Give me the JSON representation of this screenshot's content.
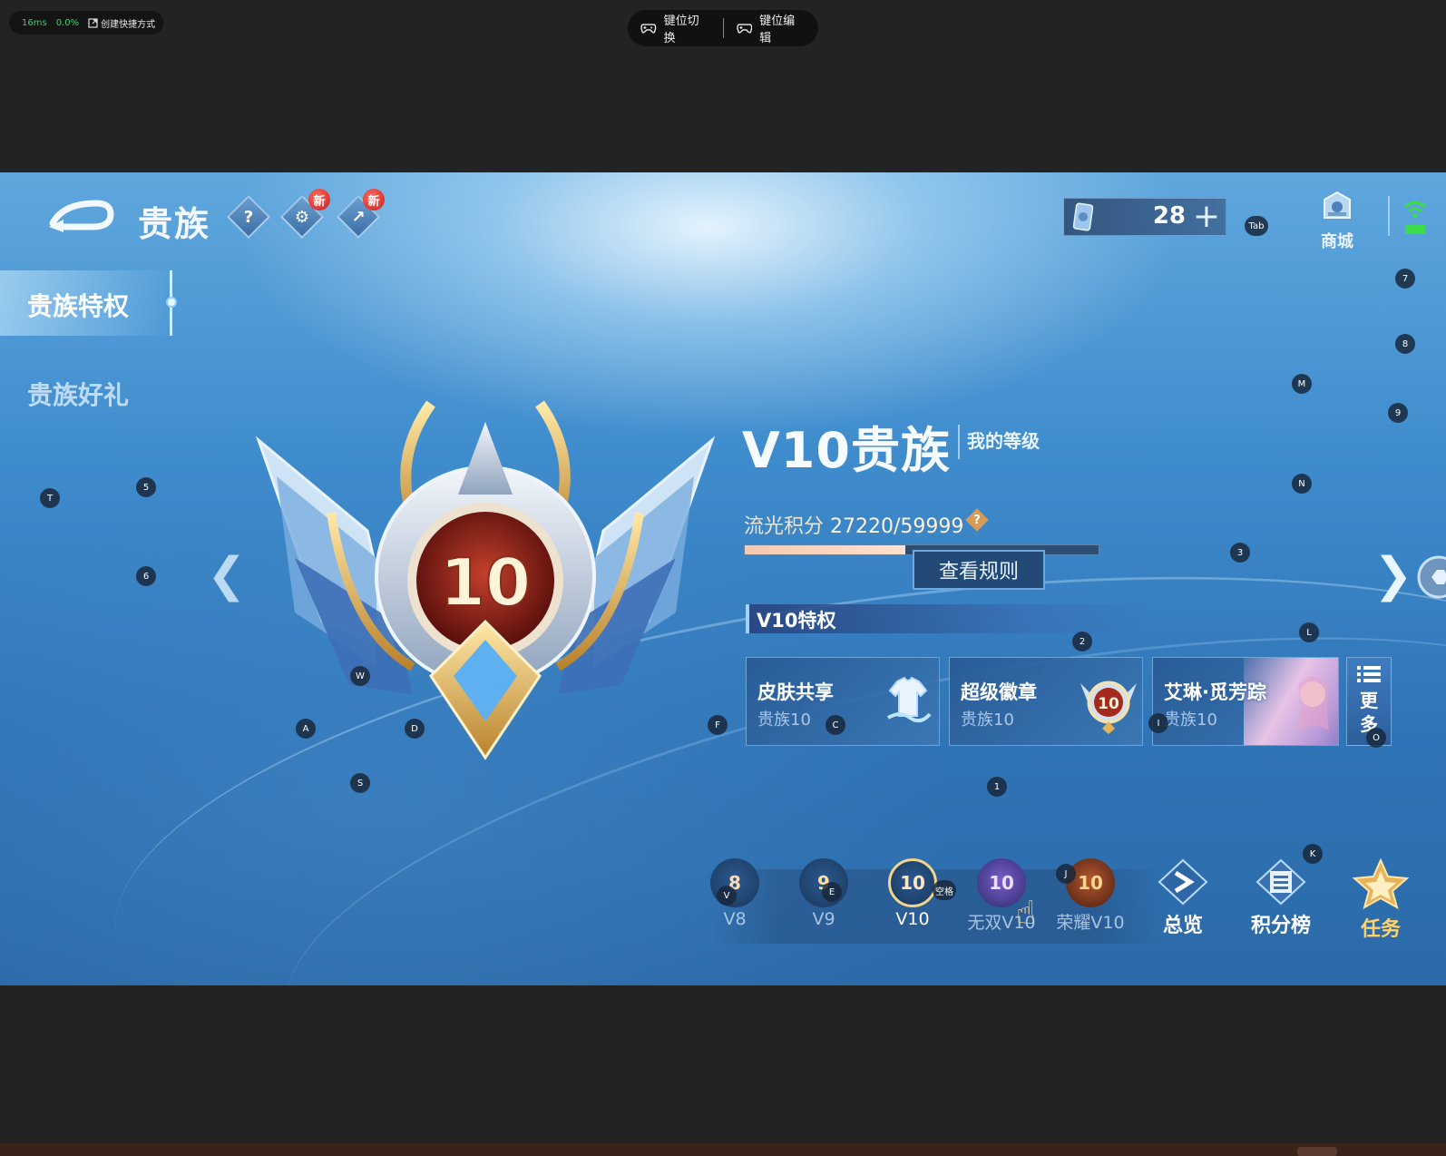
{
  "emulator": {
    "latency": "16ms",
    "loss": "0.0%",
    "shortcut_label": "创建快捷方式",
    "key_switch_label": "键位切换",
    "key_edit_label": "键位编辑"
  },
  "header": {
    "title": "贵族",
    "help_symbol": "?",
    "new_badge_1": "新",
    "new_badge_2": "新",
    "currency_value": "28",
    "currency_plus": "+",
    "shop_label": "商城"
  },
  "sidebar": {
    "items": [
      {
        "label": "贵族特权",
        "active": true
      },
      {
        "label": "贵族好礼",
        "active": false
      }
    ]
  },
  "level": {
    "badge_number": "10",
    "title": "V10贵族",
    "my_level_label": "我的等级",
    "points_label": "流光积分",
    "points_value": "27220/59999",
    "points_current": 27220,
    "points_max": 59999,
    "help_symbol": "?",
    "rules_button": "查看规则"
  },
  "privileges": {
    "header": "V10特权",
    "cards": [
      {
        "title": "皮肤共享",
        "subtitle": "贵族10"
      },
      {
        "title": "超级徽章",
        "subtitle": "贵族10",
        "emblem_number": "10"
      },
      {
        "title": "艾琳·觅芳踪",
        "subtitle": "贵族10"
      }
    ],
    "more_line1": "更",
    "more_line2": "多"
  },
  "tabs": [
    {
      "label": "V8",
      "number": "8",
      "active": false
    },
    {
      "label": "V9",
      "number": "9",
      "active": false
    },
    {
      "label": "V10",
      "number": "10",
      "active": true
    },
    {
      "label": "无双V10",
      "number": "10",
      "active": false
    },
    {
      "label": "荣耀V10",
      "number": "10",
      "active": false
    }
  ],
  "actions": {
    "overview": "总览",
    "leaderboard": "积分榜",
    "tasks": "任务"
  },
  "key_hints": {
    "tab": "Tab",
    "n7": "7",
    "n8": "8",
    "m": "M",
    "n9": "9",
    "n": "N",
    "t": "T",
    "n5": "5",
    "n6": "6",
    "n3": "3",
    "n2": "2",
    "l": "L",
    "w": "W",
    "a": "A",
    "d": "D",
    "f": "F",
    "c": "C",
    "i": "I",
    "o": "O",
    "s": "S",
    "n1": "1",
    "k": "K",
    "v": "V",
    "e": "E",
    "space": "空格",
    "j": "J"
  },
  "colors": {
    "accent_gold": "#f1d48e",
    "task_gold": "#ffd36a",
    "new_badge_red": "#c81f1f",
    "wifi_green": "#3ddc4a"
  }
}
